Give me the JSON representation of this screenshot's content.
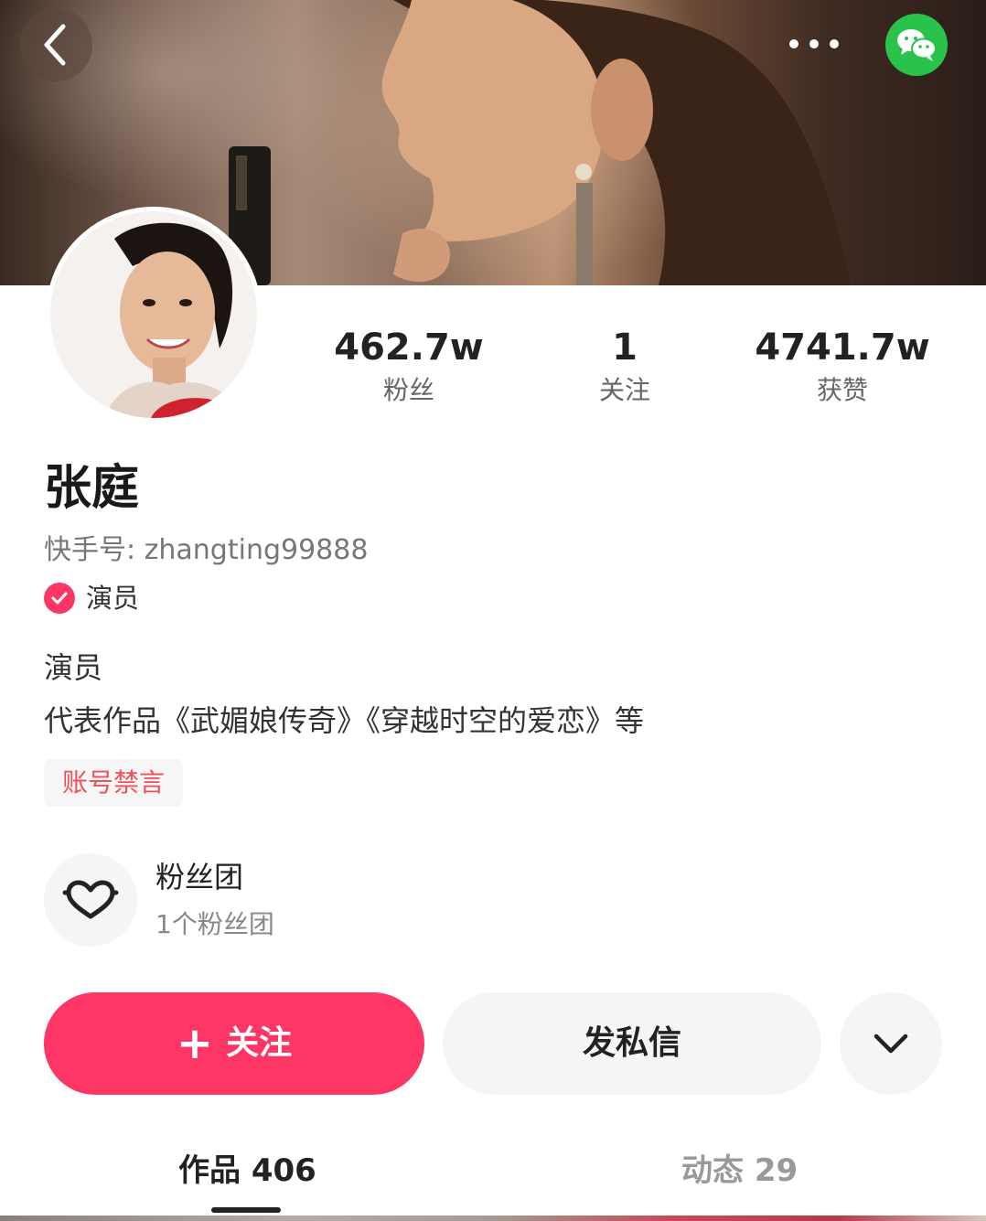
{
  "header": {
    "cover_image": "cover-photo",
    "back_icon": "chevron-left-icon",
    "more_icon": "more-dots-icon",
    "share_icon": "wechat-icon",
    "share_color": "#29c24b"
  },
  "profile": {
    "avatar": "avatar-photo",
    "name": "张庭",
    "kwai_id": "快手号: zhangting99888",
    "verify_icon": "verified-check-icon",
    "verify_label": "演员",
    "bio": [
      "演员",
      "代表作品《武媚娘传奇》《穿越时空的爱恋》等"
    ],
    "ban_tag": "账号禁言"
  },
  "stats": [
    {
      "value": "462.7w",
      "label": "粉丝"
    },
    {
      "value": "1",
      "label": "关注"
    },
    {
      "value": "4741.7w",
      "label": "获赞"
    }
  ],
  "fan_club": {
    "icon": "heart-icon",
    "title": "粉丝团",
    "subtitle": "1个粉丝团"
  },
  "actions": {
    "follow_plus": "+",
    "follow_label": "关注",
    "message_label": "发私信",
    "expand_icon": "chevron-down-icon"
  },
  "tabs": [
    {
      "label": "作品 406",
      "active": true
    },
    {
      "label": "动态 29",
      "active": false
    }
  ],
  "colors": {
    "accent": "#fe3666",
    "ban_text": "#f0505a",
    "wechat": "#29c24b"
  }
}
